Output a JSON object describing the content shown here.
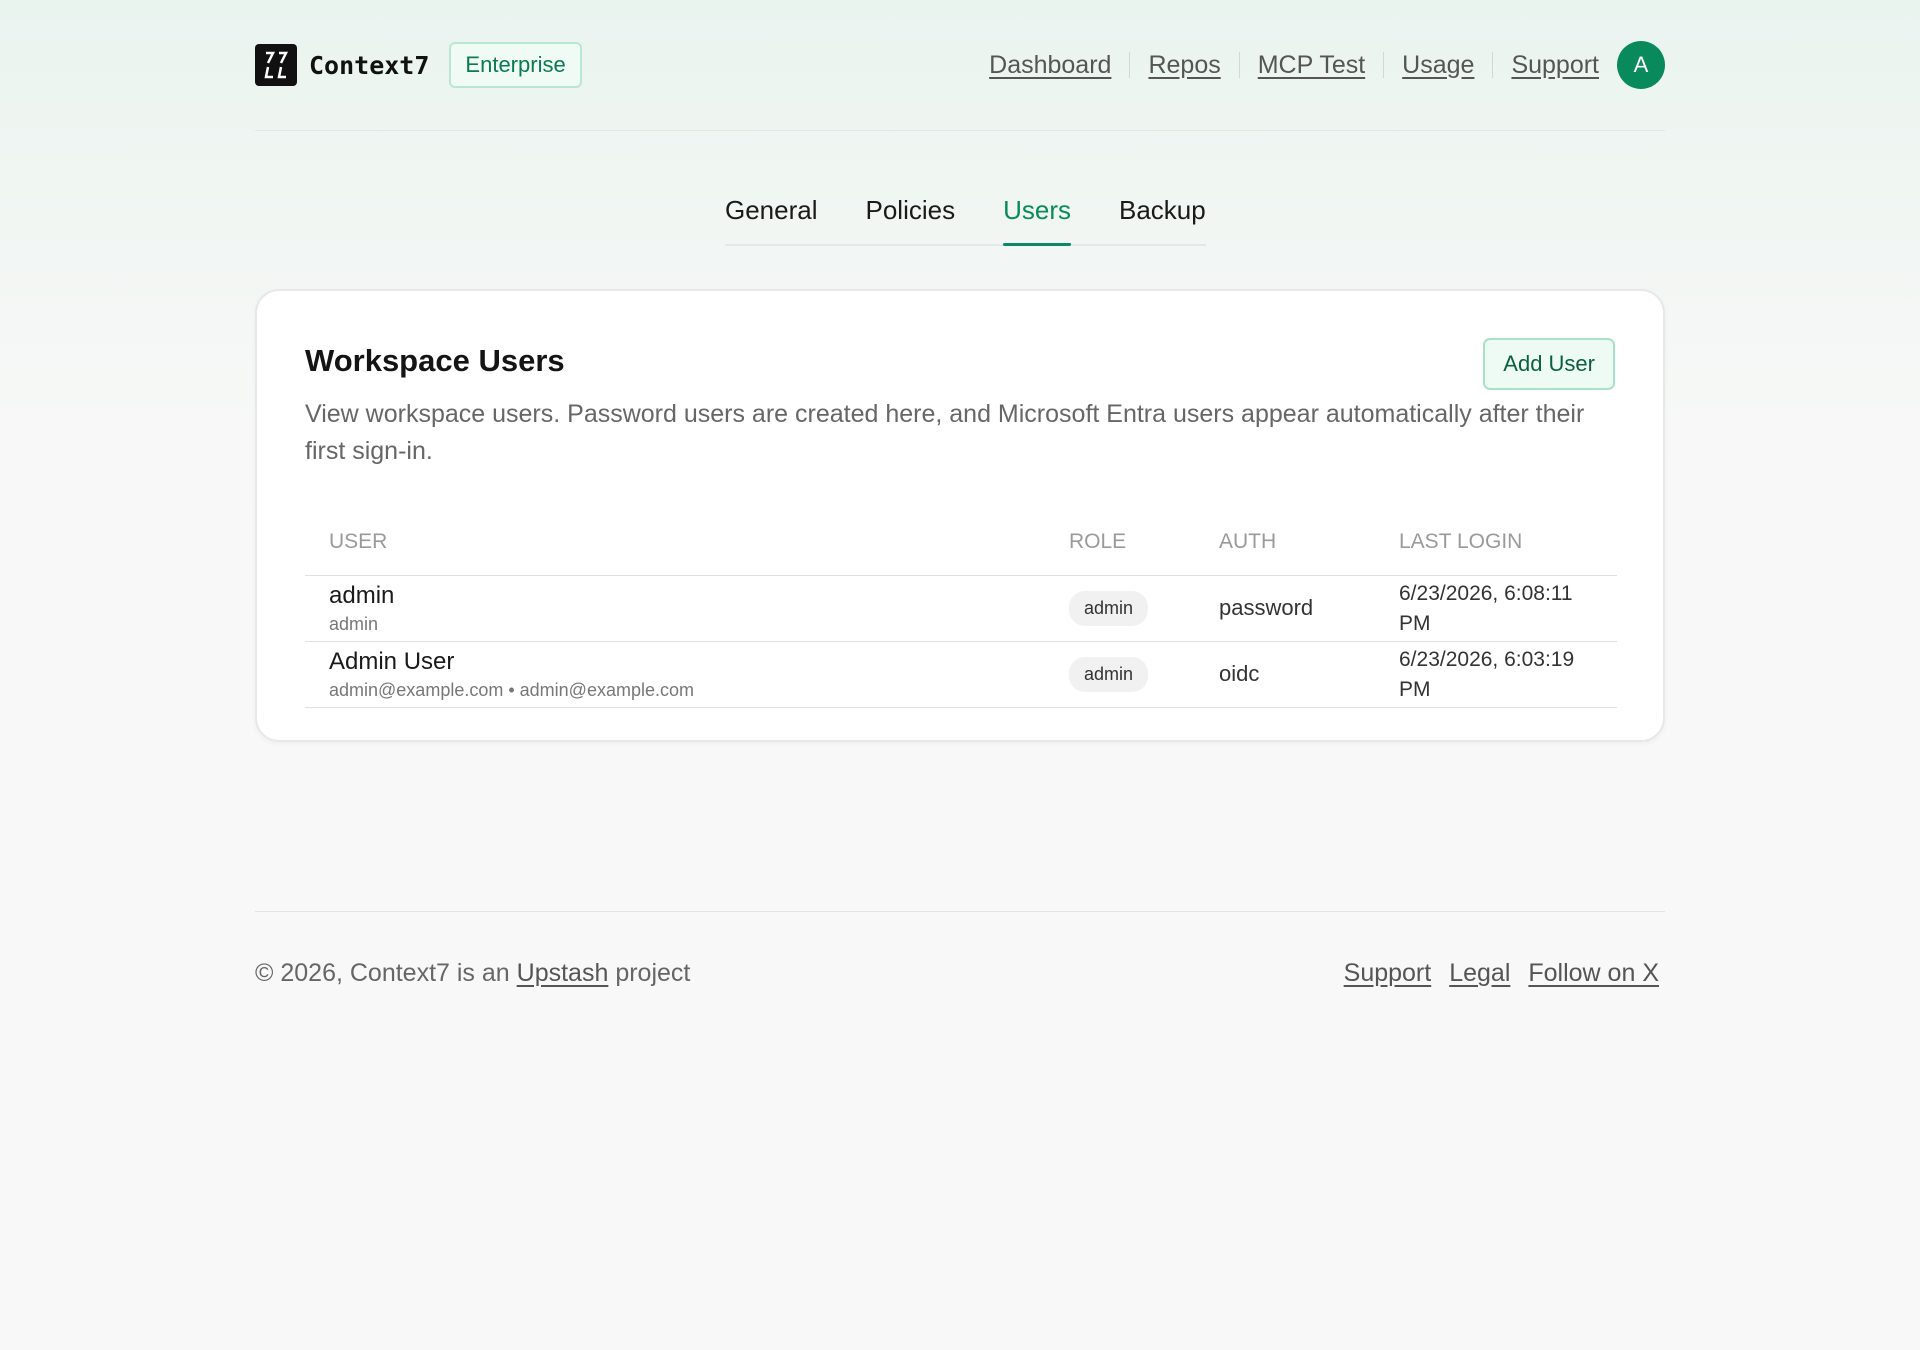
{
  "header": {
    "brand_name": "Context7",
    "badge": "Enterprise",
    "nav": [
      "Dashboard",
      "Repos",
      "MCP Test",
      "Usage",
      "Support"
    ],
    "avatar_initial": "A",
    "colors": {
      "accent": "#0a8a5d",
      "avatar_bg": "#098a5d"
    }
  },
  "tabs": [
    {
      "label": "General",
      "active": false
    },
    {
      "label": "Policies",
      "active": false
    },
    {
      "label": "Users",
      "active": true
    },
    {
      "label": "Backup",
      "active": false
    }
  ],
  "card": {
    "title": "Workspace Users",
    "add_user_label": "Add User",
    "description": "View workspace users. Password users are created here, and Microsoft Entra users appear automatically after their first sign-in.",
    "columns": [
      "USER",
      "ROLE",
      "AUTH",
      "LAST LOGIN"
    ],
    "rows": [
      {
        "name": "admin",
        "sub": "admin",
        "role": "admin",
        "auth": "password",
        "last_login": "6/23/2026, 6:08:11 PM"
      },
      {
        "name": "Admin User",
        "sub": "admin@example.com • admin@example.com",
        "role": "admin",
        "auth": "oidc",
        "last_login": "6/23/2026, 6:03:19 PM"
      }
    ]
  },
  "footer": {
    "copyright_prefix": "© 2026, Context7 is an",
    "copyright_link": "Upstash",
    "copyright_suffix": "project",
    "links": [
      "Support",
      "Legal",
      "Follow on X"
    ]
  }
}
